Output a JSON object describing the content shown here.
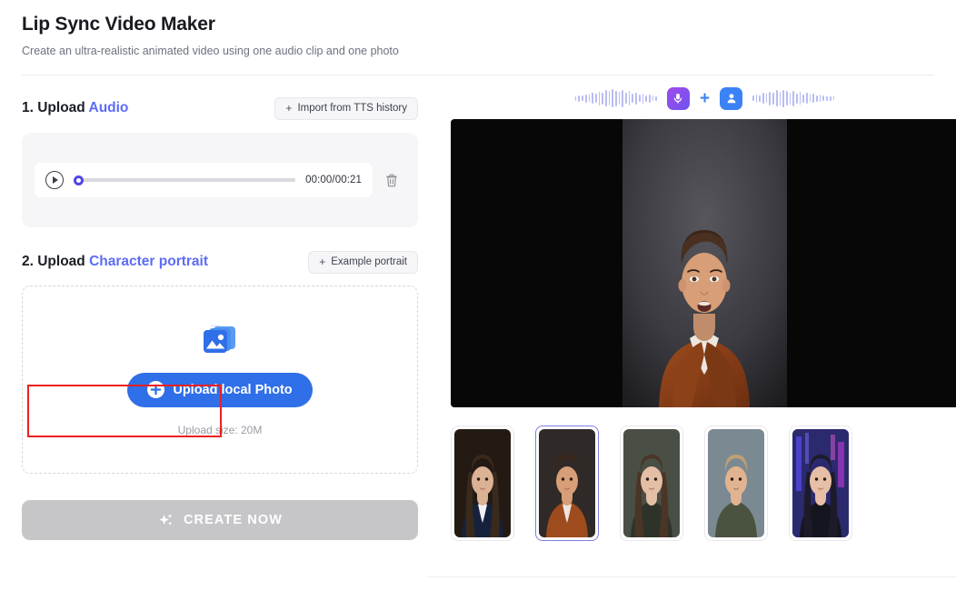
{
  "header": {
    "title": "Lip Sync Video Maker",
    "subtitle": "Create an ultra-realistic animated video using one audio clip and one photo"
  },
  "audio_section": {
    "step_number": "1. Upload ",
    "step_accent": "Audio",
    "import_button": "Import from TTS history",
    "import_button_plus": "+",
    "player": {
      "play_icon": "play-icon",
      "current_time": "00:00",
      "separator": "/",
      "duration": "00:21",
      "time_display": "00:00/00:21",
      "progress_percent": 0,
      "delete_icon": "trash-icon"
    }
  },
  "portrait_section": {
    "step_number": "2. Upload ",
    "step_accent": "Character portrait",
    "example_button": "Example portrait",
    "example_button_plus": "+",
    "dropzone": {
      "image_icon": "photos-stack-icon",
      "upload_button": "Upload local Photo",
      "upload_button_icon": "plus-circle-icon",
      "hint": "Upload size: 20M"
    },
    "annotation": {
      "type": "red-highlight-box",
      "color": "#ef2020"
    }
  },
  "create_button": {
    "label": "CREATE NOW",
    "icon": "sparkle-icon",
    "disabled": true
  },
  "preview": {
    "banner": {
      "mic_icon": "microphone-icon",
      "plus": "+",
      "person_icon": "person-icon",
      "left_waveform": "waveform-icon",
      "right_waveform": "waveform-icon"
    },
    "selected_index": 1,
    "thumbnails": [
      {
        "name": "portrait-woman-dark-suit",
        "selected": false
      },
      {
        "name": "portrait-man-brown-coat",
        "selected": true
      },
      {
        "name": "portrait-woman-long-hair",
        "selected": false
      },
      {
        "name": "portrait-man-green-shirt",
        "selected": false
      },
      {
        "name": "portrait-woman-cyberpunk",
        "selected": false
      }
    ]
  },
  "colors": {
    "accent_blue": "#5c6cf5",
    "button_blue": "#2f6fe8",
    "annotation_red": "#ef2020",
    "disabled_gray": "#c6c6c9",
    "slider_thumb": "#4f46e5"
  }
}
